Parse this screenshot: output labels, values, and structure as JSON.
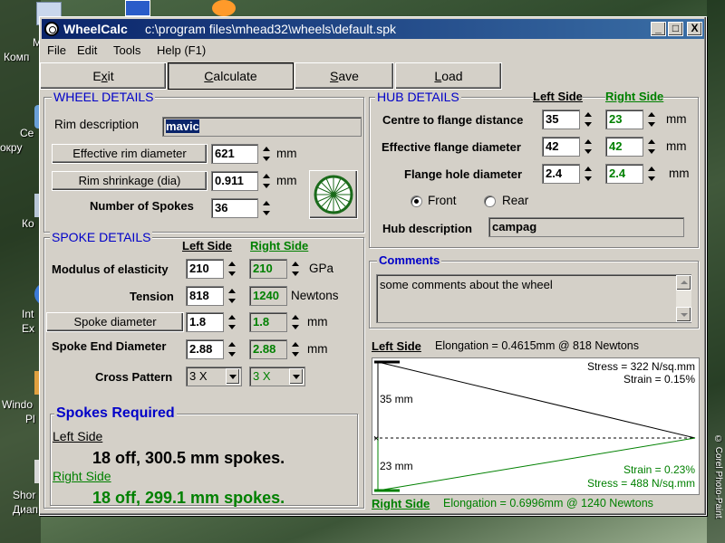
{
  "desktop": {
    "labels": [
      "М",
      "Комп",
      "Се",
      "окру",
      "Ко",
      "Int",
      "Ex",
      "Windo",
      "Pl",
      "Shor",
      "Диап"
    ],
    "vertical_text": "© Corel Photo-Paint"
  },
  "window": {
    "app_name": "WheelCalc",
    "file_path": "c:\\program files\\mhead32\\wheels\\default.spk",
    "controls": {
      "minimize": "_",
      "maximize": "□",
      "close": "X"
    }
  },
  "menu": [
    "File",
    "Edit",
    "Tools",
    "Help (F1)"
  ],
  "toolbar": {
    "exit": "Exit",
    "calculate": "Calculate",
    "save": "Save",
    "load": "Load"
  },
  "wheel": {
    "title": "WHEEL DETAILS",
    "rim_description_label": "Rim description",
    "rim_description": "mavic",
    "effective_rim_diameter_label": "Effective rim diameter",
    "effective_rim_diameter": "621",
    "erd_unit": "mm",
    "rim_shrinkage_label": "Rim shrinkage (dia)",
    "rim_shrinkage": "0.911",
    "shrink_unit": "mm",
    "spokes_label": "Number of Spokes",
    "spokes": "36"
  },
  "hub": {
    "title": "HUB DETAILS",
    "left_side": "Left Side",
    "right_side": "Right Side",
    "centre_label": "Centre to flange distance",
    "centre_left": "35",
    "centre_right": "23",
    "flange_diam_label": "Effective flange diameter",
    "flange_left": "42",
    "flange_right": "42",
    "hole_label": "Flange hole diameter",
    "hole_left": "2.4",
    "hole_right": "2.4",
    "unit": "mm",
    "front_label": "Front",
    "rear_label": "Rear",
    "selected": "Front",
    "description_label": "Hub description",
    "description": "campag"
  },
  "spoke": {
    "title": "SPOKE DETAILS",
    "left_side": "Left Side",
    "right_side": "Right Side",
    "modulus_label": "Modulus of elasticity",
    "modulus_left": "210",
    "modulus_right": "210",
    "modulus_unit": "GPa",
    "tension_label": "Tension",
    "tension_left": "818",
    "tension_right": "1240",
    "tension_unit": "Newtons",
    "diameter_label": "Spoke diameter",
    "diameter_left": "1.8",
    "diameter_right": "1.8",
    "diameter_unit": "mm",
    "end_label": "Spoke End Diameter",
    "end_left": "2.88",
    "end_right": "2.88",
    "end_unit": "mm",
    "cross_label": "Cross Pattern",
    "cross_left": "3 X",
    "cross_right": "3 X"
  },
  "required": {
    "title": "Spokes Required",
    "left_side": "Left Side",
    "left_result": "18 off, 300.5 mm spokes.",
    "right_side": "Right Side",
    "right_result": "18 off, 299.1 mm spokes."
  },
  "comments": {
    "title": "Comments",
    "text": "some comments about the wheel"
  },
  "graph": {
    "left_side": "Left Side",
    "left_elongation": "Elongation = 0.4615mm @ 818 Newtons",
    "right_side": "Right Side",
    "right_elongation": "Elongation = 0.6996mm @ 1240 Newtons",
    "stress_left": "Stress = 322 N/sq.mm",
    "strain_left": "Strain = 0.15%",
    "strain_right": "Strain = 0.23%",
    "stress_right": "Stress = 488 N/sq.mm",
    "left_offset": "35 mm",
    "right_offset": "23 mm",
    "left_color": "#000000",
    "right_color": "#008000"
  }
}
